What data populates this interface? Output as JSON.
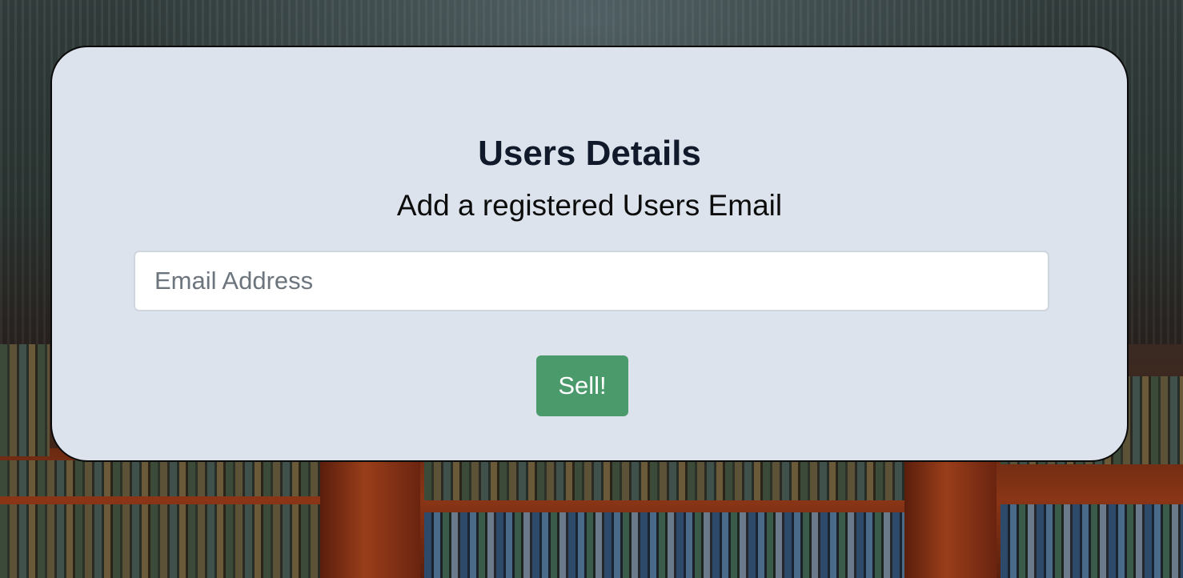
{
  "form": {
    "title": "Users Details",
    "subtitle": "Add a registered Users Email",
    "email": {
      "value": "",
      "placeholder": "Email Address"
    },
    "submit_label": "Sell!"
  },
  "colors": {
    "card_background": "#dce3ec",
    "title_text": "#101a2b",
    "button_background": "#4b9a6b",
    "button_text": "#ffffff"
  }
}
